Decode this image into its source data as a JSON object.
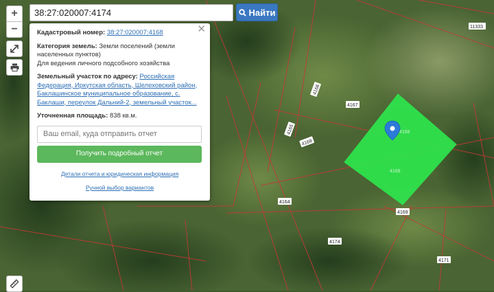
{
  "search": {
    "value": "38:27:020007:4174",
    "button_label": "Найти"
  },
  "controls": {
    "zoom_in": "+",
    "zoom_out": "−"
  },
  "popup": {
    "cadastral_label": "Кадастровый номер:",
    "cadastral_value": "38:27:020007:4168",
    "category_label": "Категория земель:",
    "category_value": "Земли поселений (земли населенных пунктов)",
    "usage": "Для ведения личного подсобного хозяйства",
    "address_label": "Земельный участок по адресу:",
    "address_value": "Российская Федерация, Иркутская область, Шелеховский район, Баклашинское муниципальное образование, с. Баклаши, переулок Дальний-2, земельный участок...",
    "area_label": "Уточненная площадь:",
    "area_value": "838 кв.м.",
    "email_placeholder": "Ваш email, куда отправить отчет",
    "report_button": "Получить подробный отчет",
    "details_link": "Детали отчета и юридическая информация",
    "manual_link": "Ручной выбор вариантов"
  },
  "map_labels": {
    "l4167": "4167",
    "l4169a": "4169",
    "l4169b": "4169",
    "l4164": "4164",
    "l4174": "4174",
    "l4171": "4171",
    "l4165": "4165",
    "l4168": "4168",
    "l11333": "11333",
    "lselected": "4168",
    "lselected2": "4168"
  },
  "colors": {
    "selected_parcel": "#2ee64d",
    "boundary": "#c23a36",
    "button_blue": "#3a78c1",
    "button_green": "#5cb85c"
  }
}
